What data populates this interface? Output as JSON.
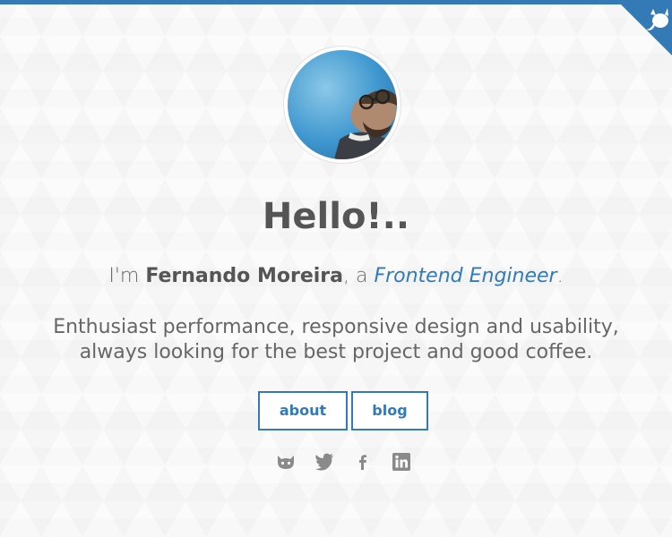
{
  "colors": {
    "accent": "#337ab7",
    "text": "#555555",
    "background": "#fbfbfb"
  },
  "header": {
    "corner_icon": "github-cat-icon"
  },
  "profile": {
    "avatar_alt": "avatar"
  },
  "hero": {
    "headline": "Hello!..",
    "intro_prefix": "I'm ",
    "name": "Fernando Moreira",
    "intro_middle": ", a ",
    "role": "Frontend Engineer",
    "intro_suffix": ".",
    "description": "Enthusiast performance, responsive design and usability, always looking for the best project and good coffee."
  },
  "nav": {
    "about_label": "about",
    "blog_label": "blog"
  },
  "social": {
    "items": [
      {
        "icon": "github-icon"
      },
      {
        "icon": "twitter-icon"
      },
      {
        "icon": "facebook-icon"
      },
      {
        "icon": "linkedin-icon"
      }
    ]
  }
}
